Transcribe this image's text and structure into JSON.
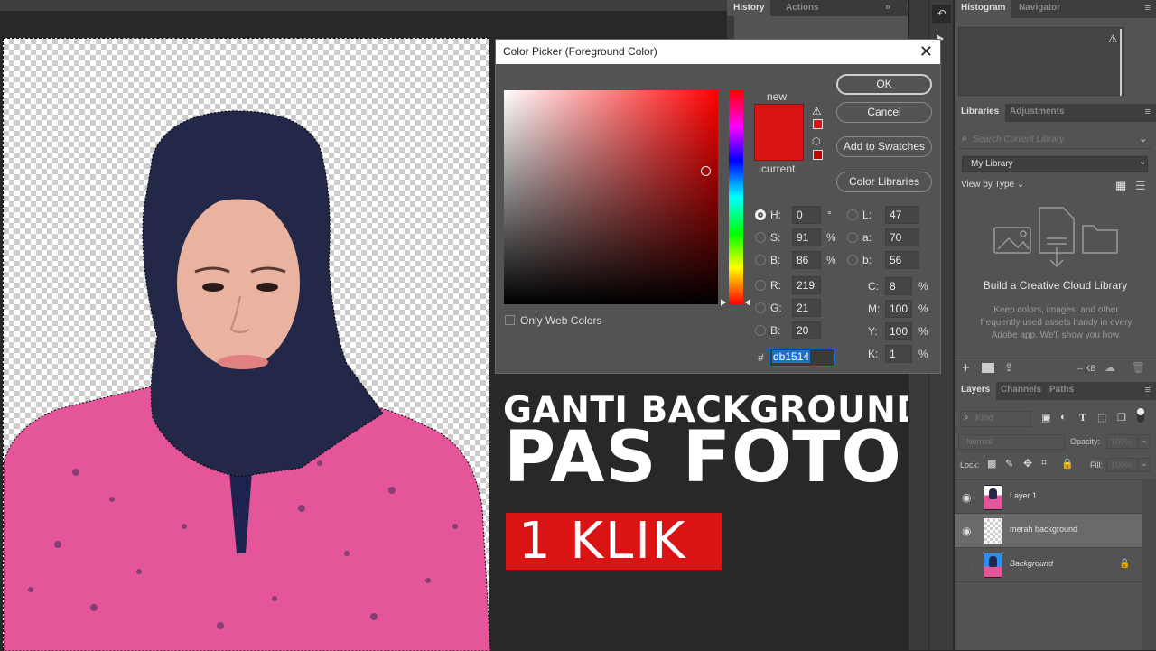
{
  "thumbnail": {
    "line1": "GANTI BACKGROUND",
    "line2": "PAS FOTO",
    "badge": "1 KLIK",
    "badge_color": "#da1414"
  },
  "history_panel": {
    "tabs": [
      "History",
      "Actions"
    ],
    "active_tab": "History",
    "expand_icon": "double-chevron-right-icon",
    "menu_icon": "hamburger-menu-icon"
  },
  "color_picker": {
    "title": "Color Picker (Foreground Color)",
    "close_icon": "close-icon",
    "new_label": "new",
    "current_label": "current",
    "new_color": "#db1514",
    "current_color": "#db1514",
    "gamut_warning_icon": "warning-triangle-icon",
    "websafe_icon": "cube-icon",
    "buttons": {
      "ok": "OK",
      "cancel": "Cancel",
      "add_to_swatches": "Add to Swatches",
      "color_libraries": "Color Libraries"
    },
    "fields": {
      "H": {
        "label": "H:",
        "value": "0",
        "unit": "°",
        "selected": true
      },
      "S": {
        "label": "S:",
        "value": "91",
        "unit": "%"
      },
      "Bv": {
        "label": "B:",
        "value": "86",
        "unit": "%"
      },
      "R": {
        "label": "R:",
        "value": "219"
      },
      "G": {
        "label": "G:",
        "value": "21"
      },
      "Bc": {
        "label": "B:",
        "value": "20"
      },
      "L": {
        "label": "L:",
        "value": "47"
      },
      "a": {
        "label": "a:",
        "value": "70"
      },
      "b": {
        "label": "b:",
        "value": "56"
      },
      "C": {
        "label": "C:",
        "value": "8",
        "unit": "%"
      },
      "M": {
        "label": "M:",
        "value": "100",
        "unit": "%"
      },
      "Y": {
        "label": "Y:",
        "value": "100",
        "unit": "%"
      },
      "K": {
        "label": "K:",
        "value": "1",
        "unit": "%"
      }
    },
    "hex_prefix": "#",
    "hex_value": "db1514",
    "only_web_colors_label": "Only Web Colors",
    "only_web_colors_checked": false
  },
  "histogram_panel": {
    "tabs": [
      "Histogram",
      "Navigator"
    ],
    "active_tab": "Histogram"
  },
  "libraries_panel": {
    "tabs": [
      "Libraries",
      "Adjustments"
    ],
    "active_tab": "Libraries",
    "search_placeholder": "Search Current Library",
    "library_select": "My Library",
    "view_by": "View by Type",
    "empty_title": "Build a Creative Cloud Library",
    "empty_desc": "Keep colors, images, and other frequently used assets handy in every Adobe app. We'll show you how.",
    "storage": "-- KB"
  },
  "layers_panel": {
    "tabs": [
      "Layers",
      "Channels",
      "Paths"
    ],
    "active_tab": "Layers",
    "kind_placeholder": "Kind",
    "blend_mode": "Normal",
    "opacity_label": "Opacity:",
    "opacity_value": "100%",
    "lock_label": "Lock:",
    "fill_label": "Fill:",
    "fill_value": "100%",
    "layers": [
      {
        "name": "Layer 1",
        "visible": true,
        "selected": false,
        "italic": false,
        "locked": false
      },
      {
        "name": "merah background",
        "visible": true,
        "selected": true,
        "italic": false,
        "locked": false
      },
      {
        "name": "Background",
        "visible": false,
        "selected": false,
        "italic": true,
        "locked": true
      }
    ]
  }
}
